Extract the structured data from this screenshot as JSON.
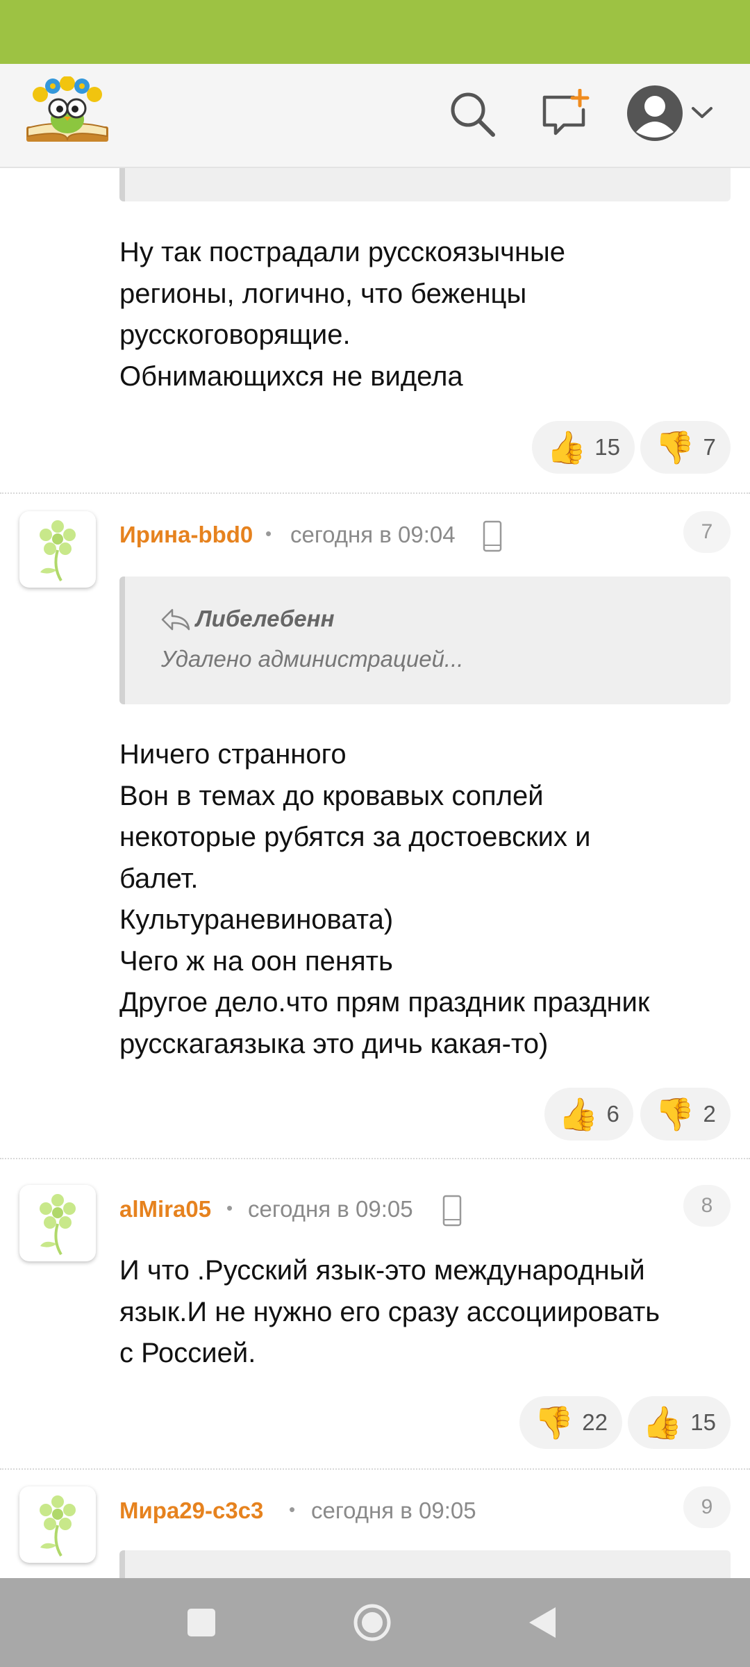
{
  "header": {
    "logo_icon": "reading-owl-logo",
    "search_icon": "search-icon",
    "new_message_icon": "new-message-icon",
    "profile_icon": "user-avatar-icon"
  },
  "comments": [
    {
      "text": "Ну так пострадали русскоязычные\nрегионы, логично, что беженцы\nрусскоговорящие.\nОбнимающихся не видела",
      "likes": "15",
      "dislikes": "7"
    },
    {
      "number": "7",
      "username": "Ирина-bbd0",
      "time": "сегодня в 09:04",
      "quote_author": "Либелебенн",
      "quote_text": "Удалено администрацией...",
      "text": "Ничего странного\nВон в темах до кровавых соплей\nнекоторые рубятся за достоевских и\nбалет.\nКультураневиновата)\nЧего ж на оон пенять\nДругое дело.что прям праздник праздник\nрусскагаязыка это дичь какая-то)",
      "likes": "6",
      "dislikes": "2"
    },
    {
      "number": "8",
      "username": "alMira05",
      "time": "сегодня в 09:05",
      "text": "И что .Русский язык-это международный\nязык.И не нужно его сразу ассоциировать\nс Россией.",
      "dislikes": "22",
      "likes": "15"
    },
    {
      "number": "9",
      "username": "Мира29-c3c3",
      "time": "сегодня в 09:05"
    }
  ],
  "colors": {
    "status_bar": "#9dc243",
    "username": "#e6821e",
    "nav_bar": "#a8a8a8"
  }
}
